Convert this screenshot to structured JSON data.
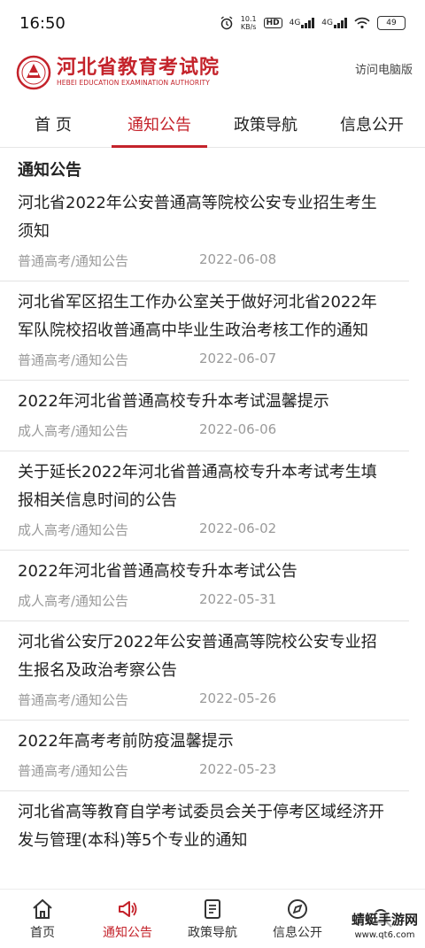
{
  "status": {
    "time": "16:50",
    "net_speed_value": "10.1",
    "net_speed_unit": "KB/s",
    "hd": "HD",
    "sig1": "4G",
    "sig2": "4G",
    "battery": "49"
  },
  "header": {
    "logo_cn": "河北省教育考试院",
    "logo_en": "HEBEI EDUCATION EXAMINATION AUTHORITY",
    "desktop_link": "访问电脑版"
  },
  "nav": {
    "tabs": [
      {
        "label": "首 页"
      },
      {
        "label": "通知公告"
      },
      {
        "label": "政策导航"
      },
      {
        "label": "信息公开"
      }
    ]
  },
  "section_title": "通知公告",
  "items": [
    {
      "title": "河北省2022年公安普通高等院校公安专业招生考生须知",
      "category": "普通高考/通知公告",
      "date": "2022-06-08"
    },
    {
      "title": "河北省军区招生工作办公室关于做好河北省2022年军队院校招收普通高中毕业生政治考核工作的通知",
      "category": "普通高考/通知公告",
      "date": "2022-06-07"
    },
    {
      "title": "2022年河北省普通高校专升本考试温馨提示",
      "category": "成人高考/通知公告",
      "date": "2022-06-06"
    },
    {
      "title": "关于延长2022年河北省普通高校专升本考试考生填报相关信息时间的公告",
      "category": "成人高考/通知公告",
      "date": "2022-06-02"
    },
    {
      "title": "2022年河北省普通高校专升本考试公告",
      "category": "成人高考/通知公告",
      "date": "2022-05-31"
    },
    {
      "title": "河北省公安厅2022年公安普通高等院校公安专业招生报名及政治考察公告",
      "category": "普通高考/通知公告",
      "date": "2022-05-26"
    },
    {
      "title": "2022年高考考前防疫温馨提示",
      "category": "普通高考/通知公告",
      "date": "2022-05-23"
    },
    {
      "title": "河北省高等教育自学考试委员会关于停考区域经济开发与管理(本科)等5个专业的通知",
      "category": "",
      "date": ""
    }
  ],
  "tabbar": {
    "tabs": [
      {
        "label": "首页"
      },
      {
        "label": "通知公告"
      },
      {
        "label": "政策导航"
      },
      {
        "label": "信息公开"
      },
      {
        "label": ""
      }
    ]
  },
  "watermark": {
    "text": "蜻蜓手游网",
    "url": "www.qt6.com"
  },
  "colors": {
    "accent": "#c4232b"
  }
}
